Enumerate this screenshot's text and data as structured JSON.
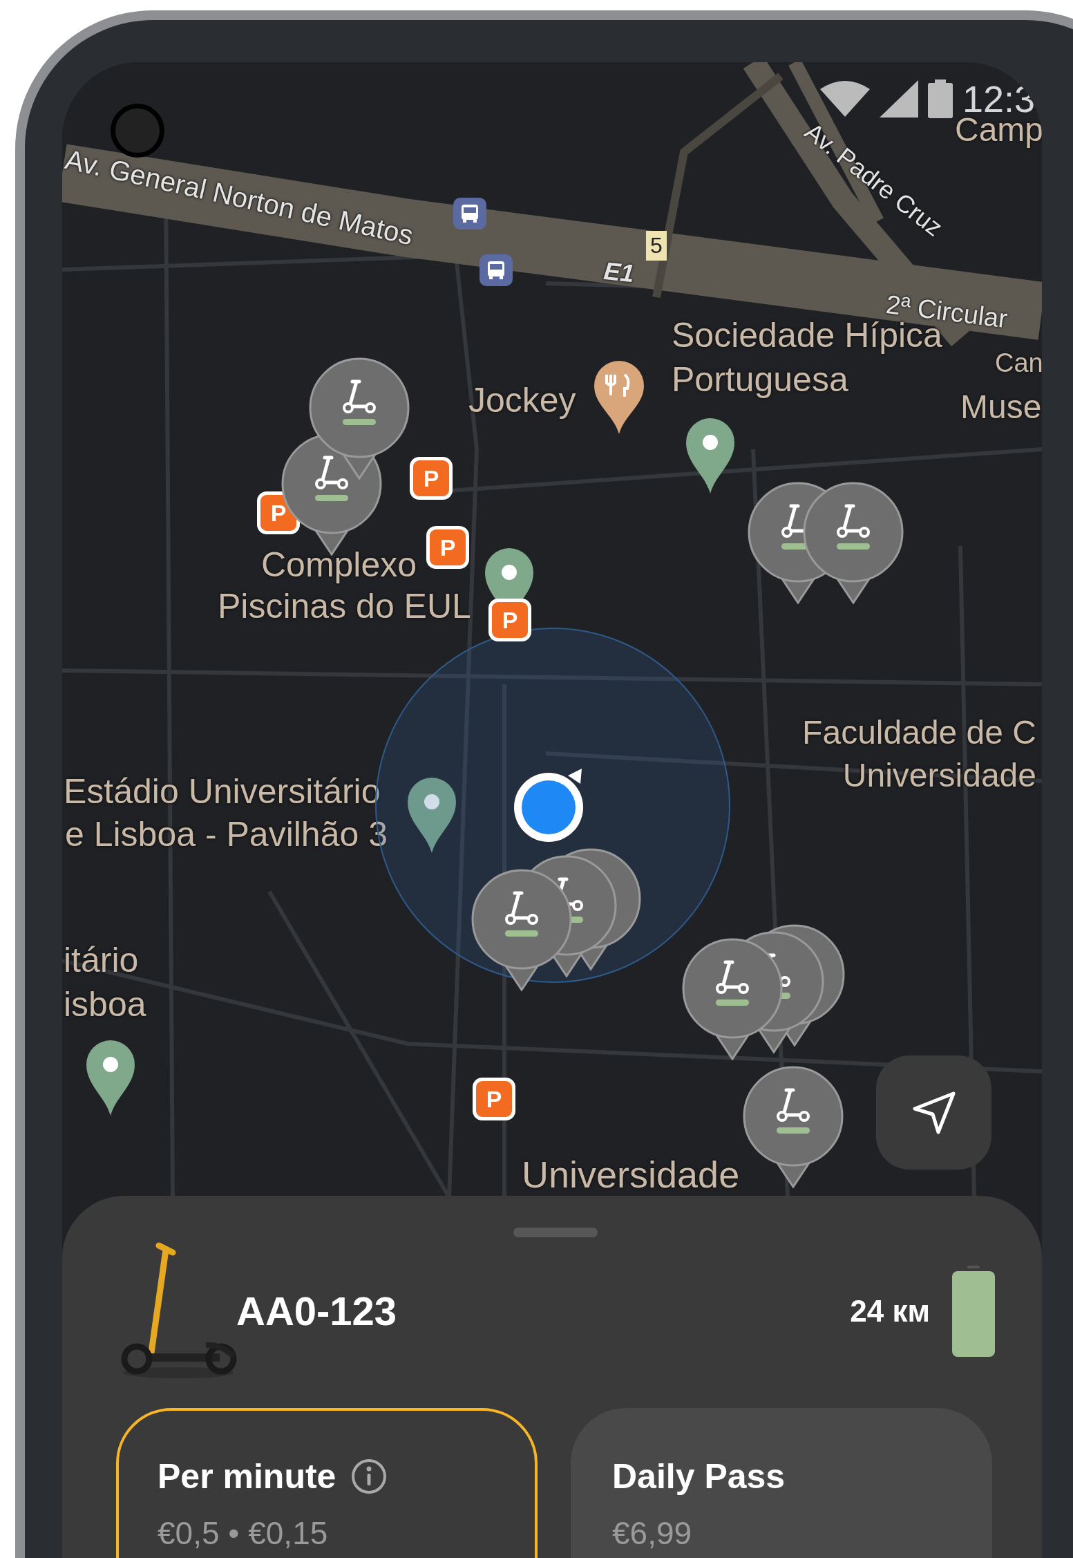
{
  "status_bar": {
    "time": "12:3"
  },
  "map": {
    "labels": [
      {
        "text": "Av. General Norton de Matos",
        "kind": "road"
      },
      {
        "text": "Av. Padre Cruz",
        "kind": "road"
      },
      {
        "text": "E1",
        "kind": "route"
      },
      {
        "text": "5",
        "kind": "shield"
      },
      {
        "text": "2ª Circular",
        "kind": "road"
      },
      {
        "text": "Camp",
        "kind": "place"
      },
      {
        "text": "Sociedade Hípica",
        "kind": "place"
      },
      {
        "text": "Portuguesa",
        "kind": "place"
      },
      {
        "text": "Can",
        "kind": "place"
      },
      {
        "text": "Jockey",
        "kind": "place"
      },
      {
        "text": "Muse",
        "kind": "place"
      },
      {
        "text": "Complexo",
        "kind": "place"
      },
      {
        "text": "Piscinas do EUL",
        "kind": "place"
      },
      {
        "text": "Faculdade de C",
        "kind": "place"
      },
      {
        "text": "Universidade",
        "kind": "place"
      },
      {
        "text": "Estádio Universitário",
        "kind": "place"
      },
      {
        "text": "e Lisboa - Pavilhão 3",
        "kind": "place"
      },
      {
        "text": "itário",
        "kind": "place"
      },
      {
        "text": "isboa",
        "kind": "place"
      },
      {
        "text": "Universidade",
        "kind": "place"
      }
    ],
    "parking_markers": [
      "P",
      "P",
      "P",
      "P",
      "P"
    ]
  },
  "vehicle": {
    "plate": "AA0-123",
    "range": "24 км"
  },
  "plans": [
    {
      "title": "Per minute",
      "info": true,
      "price": "€0,5 • €0,15",
      "selected": true
    },
    {
      "title": "Daily Pass",
      "info": false,
      "price": "€6,99",
      "selected": false
    }
  ]
}
